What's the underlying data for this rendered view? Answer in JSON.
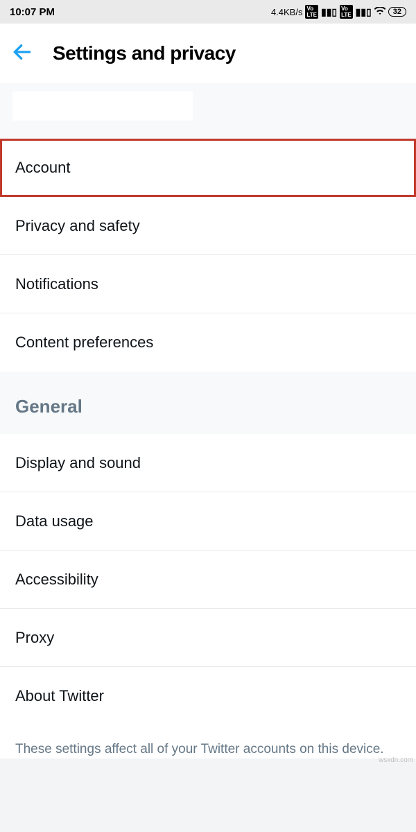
{
  "status": {
    "time": "10:07 PM",
    "net_speed": "4.4KB/s",
    "volte": "VoLTE",
    "battery": "32"
  },
  "header": {
    "title": "Settings and privacy"
  },
  "sections": {
    "main": [
      {
        "label": "Account",
        "highlighted": true
      },
      {
        "label": "Privacy and safety"
      },
      {
        "label": "Notifications"
      },
      {
        "label": "Content preferences"
      }
    ],
    "general_title": "General",
    "general": [
      {
        "label": "Display and sound"
      },
      {
        "label": "Data usage"
      },
      {
        "label": "Accessibility"
      },
      {
        "label": "Proxy"
      },
      {
        "label": "About Twitter"
      }
    ]
  },
  "footer": "These settings affect all of your Twitter accounts on this device.",
  "watermark": "wsxdn.com"
}
